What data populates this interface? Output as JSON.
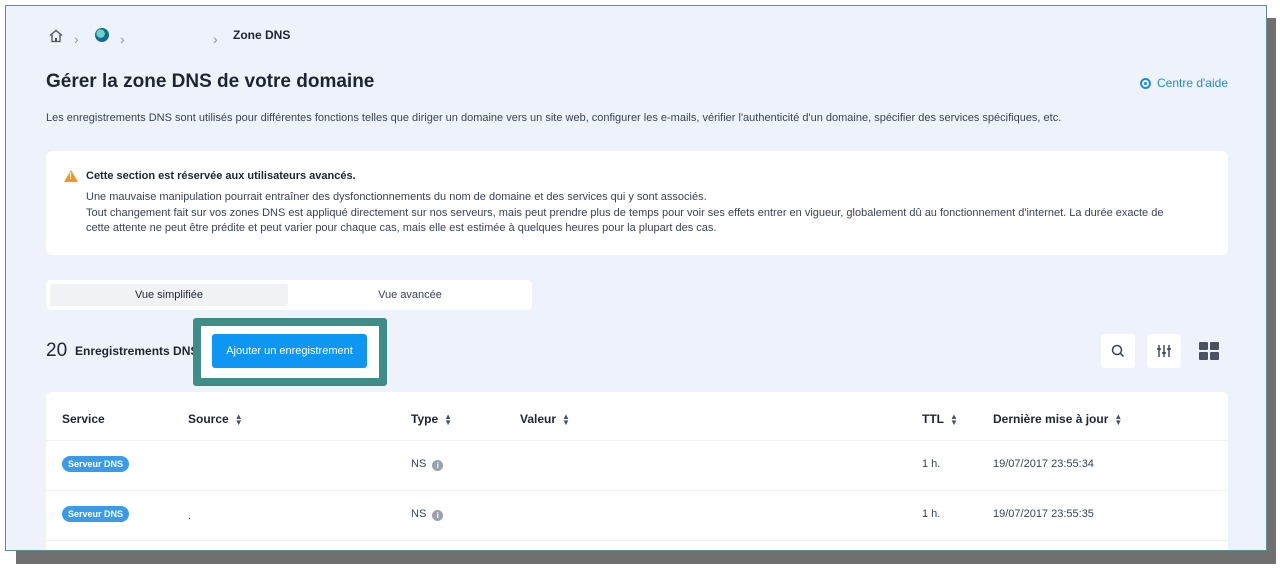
{
  "breadcrumb": {
    "current": "Zone DNS"
  },
  "title": "Gérer la zone DNS de votre domaine",
  "help_link": "Centre d'aide",
  "description": "Les enregistrements DNS sont utilisés pour différentes fonctions telles que diriger un domaine vers un site web, configurer les e-mails, vérifier l'authenticité d'un domaine, spécifier des services spécifiques, etc.",
  "warning": {
    "title": "Cette section est réservée aux utilisateurs avancés.",
    "lines": [
      "Une mauvaise manipulation pourrait entraîner des dysfonctionnements du nom de domaine et des services qui y sont associés.",
      "Tout changement fait sur vos zones DNS est appliqué directement sur nos serveurs, mais peut prendre plus de temps pour voir ses effets entrer en vigueur, globalement dû au fonctionnement d'internet. La durée exacte de",
      "cette attente ne peut être prédite et peut varier pour chaque cas, mais elle est estimée à quelques heures pour la plupart des cas."
    ],
    "icon": "warning-icon",
    "color": "#f29a16"
  },
  "tabs": [
    {
      "label": "Vue simplifiée",
      "active": true
    },
    {
      "label": "Vue avancée",
      "active": false
    }
  ],
  "records": {
    "count": "20",
    "label": "Enregistrements DNS",
    "add_button": "Ajouter un enregistrement"
  },
  "table": {
    "columns": [
      "Service",
      "Source",
      "Type",
      "Valeur",
      "TTL",
      "Dernière mise à jour"
    ],
    "rows": [
      {
        "service": "Serveur DNS",
        "source": "",
        "type": "NS",
        "value": "",
        "ttl": "1 h.",
        "updated": "19/07/2017 23:55:34"
      },
      {
        "service": "Serveur DNS",
        "source": ".",
        "type": "NS",
        "value": "",
        "ttl": "1 h.",
        "updated": "19/07/2017 23:55:35"
      }
    ]
  },
  "colors": {
    "accent": "#0d96f2",
    "highlight": "#3e8d86",
    "badge": "#3b9be8",
    "background": "#eef3fb"
  },
  "icons": [
    "home-icon",
    "globe-icon",
    "help-icon",
    "search-icon",
    "filter-icon",
    "grid-view-icon",
    "info-icon"
  ]
}
